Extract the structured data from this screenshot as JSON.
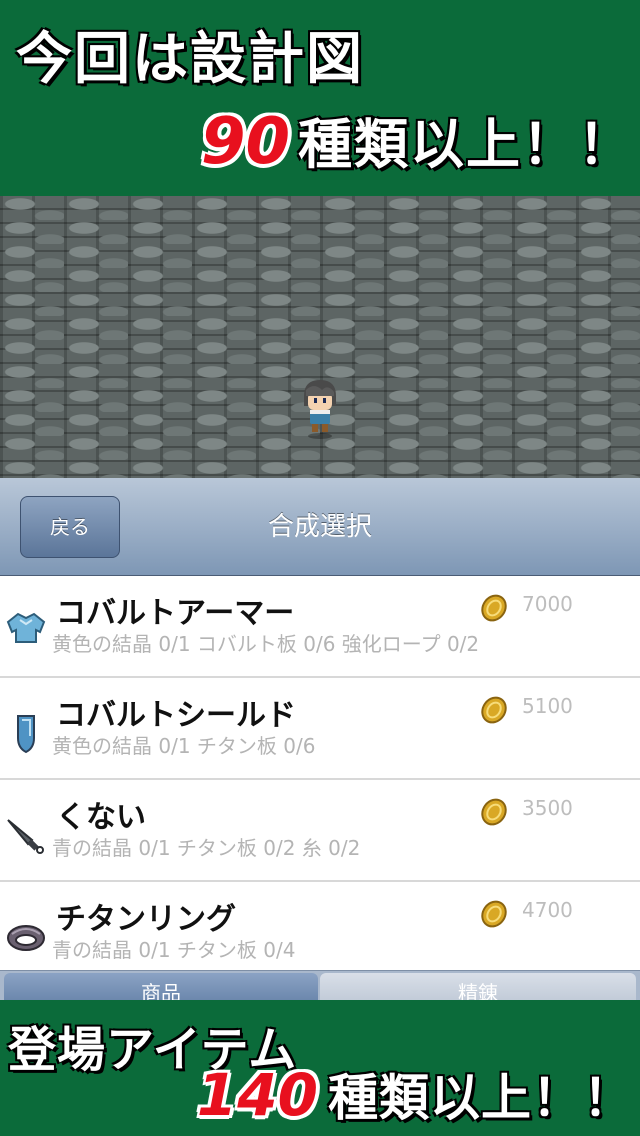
{
  "top_banner": {
    "title": "今回は設計図",
    "number": "90",
    "suffix": "種類以上！！"
  },
  "navbar": {
    "back_label": "戻る",
    "title": "合成選択"
  },
  "items": [
    {
      "name": "コバルトアーマー",
      "requirements": "黄色の結晶 0/1 コバルト板 0/6 強化ロープ 0/2",
      "price": "7000",
      "icon": "armor-icon"
    },
    {
      "name": "コバルトシールド",
      "requirements": "黄色の結晶 0/1 チタン板 0/6",
      "price": "5100",
      "icon": "shield-icon"
    },
    {
      "name": "くない",
      "requirements": "青の結晶 0/1 チタン板 0/2 糸 0/2",
      "price": "3500",
      "icon": "kunai-icon"
    },
    {
      "name": "チタンリング",
      "requirements": "青の結晶 0/1 チタン板 0/4",
      "price": "4700",
      "icon": "ring-icon"
    }
  ],
  "tabs": [
    "商品",
    "精錬"
  ],
  "bottom_banner": {
    "title": "登場アイテム",
    "number": "140",
    "suffix": "種類以上！！"
  },
  "colors": {
    "banner_green": "#0b6b3a",
    "highlight_red": "#e8101e",
    "navbar_blue": "#7e97b5"
  }
}
